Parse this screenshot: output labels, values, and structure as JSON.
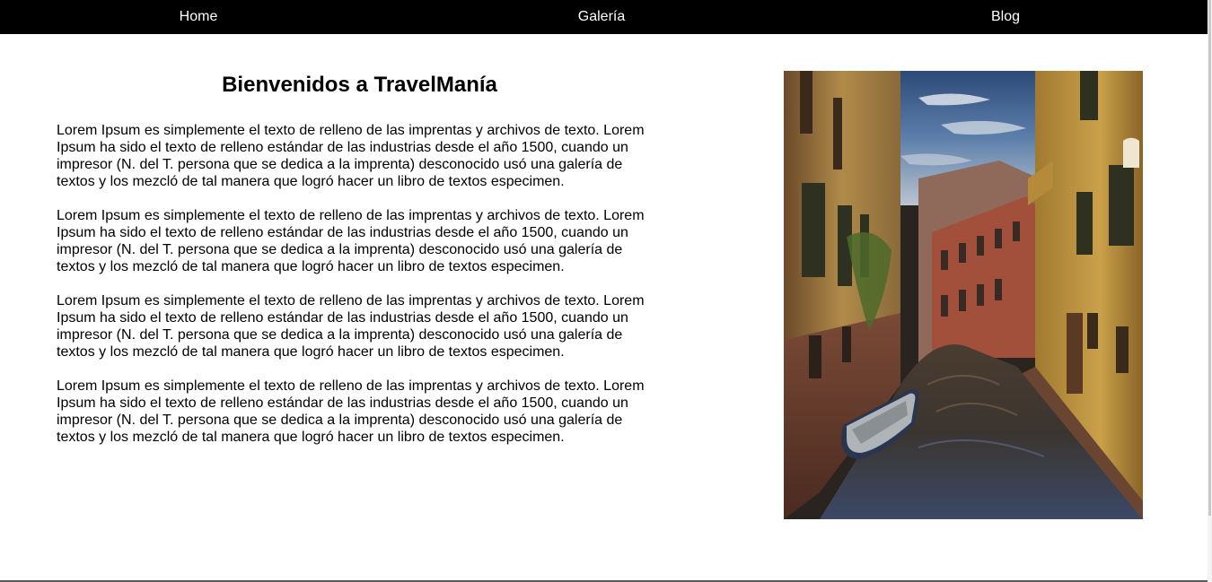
{
  "nav": {
    "items": [
      {
        "label": "Home"
      },
      {
        "label": "Galería"
      },
      {
        "label": "Blog"
      }
    ]
  },
  "main": {
    "title": "Bienvenidos a TravelManía",
    "paragraphs": [
      "Lorem Ipsum es simplemente el texto de relleno de las imprentas y archivos de texto. Lorem Ipsum ha sido el texto de relleno estándar de las industrias desde el año 1500, cuando un impresor (N. del T. persona que se dedica a la imprenta) desconocido usó una galería de textos y los mezcló de tal manera que logró hacer un libro de textos especimen.",
      "Lorem Ipsum es simplemente el texto de relleno de las imprentas y archivos de texto. Lorem Ipsum ha sido el texto de relleno estándar de las industrias desde el año 1500, cuando un impresor (N. del T. persona que se dedica a la imprenta) desconocido usó una galería de textos y los mezcló de tal manera que logró hacer un libro de textos especimen.",
      "Lorem Ipsum es simplemente el texto de relleno de las imprentas y archivos de texto. Lorem Ipsum ha sido el texto de relleno estándar de las industrias desde el año 1500, cuando un impresor (N. del T. persona que se dedica a la imprenta) desconocido usó una galería de textos y los mezcló de tal manera que logró hacer un libro de textos especimen.",
      "Lorem Ipsum es simplemente el texto de relleno de las imprentas y archivos de texto. Lorem Ipsum ha sido el texto de relleno estándar de las industrias desde el año 1500, cuando un impresor (N. del T. persona que se dedica a la imprenta) desconocido usó una galería de textos y los mezcló de tal manera que logró hacer un libro de textos especimen."
    ]
  },
  "colors": {
    "navbar_bg": "#000000",
    "nav_text": "#ffffff",
    "page_bg": "#ffffff",
    "body_text": "#000000"
  }
}
